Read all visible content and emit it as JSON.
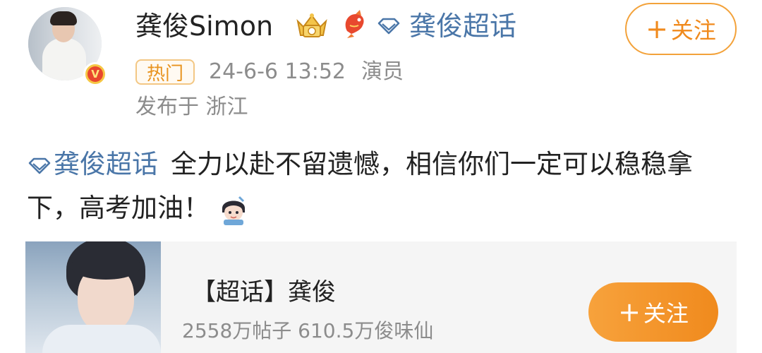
{
  "author": {
    "name": "龚俊Simon",
    "avatar_icon": "avatar-photo",
    "badge_icon": "verified-v-icon",
    "medals": [
      "crown-medal-icon",
      "koi-fish-medal-icon"
    ]
  },
  "header_topic": {
    "icon": "diamond-topic-icon",
    "label": "龚俊超话"
  },
  "follow_button_top": {
    "plus": "+",
    "label": "关注"
  },
  "meta": {
    "hot_tag": "热门",
    "timestamp": "24-6-6 13:52",
    "role": "演员",
    "location": "发布于 浙江"
  },
  "post": {
    "topic_label": "龚俊超话",
    "text": "全力以赴不留遗憾，相信你们一定可以稳稳拿下，高考加油！",
    "sticker_icon": "cartoon-sticker-icon"
  },
  "card": {
    "thumbnail_icon": "drama-poster-thumbnail",
    "title": "【超话】龚俊",
    "stats": "2558万帖子 610.5万俊味仙",
    "follow_plus": "+",
    "follow_label": "关注"
  },
  "colors": {
    "topic_blue": "#4a76a8",
    "accent_orange": "#f08a1d",
    "muted_gray": "#8c8c8c",
    "text_dark": "#222222",
    "card_bg": "#f5f5f5"
  }
}
